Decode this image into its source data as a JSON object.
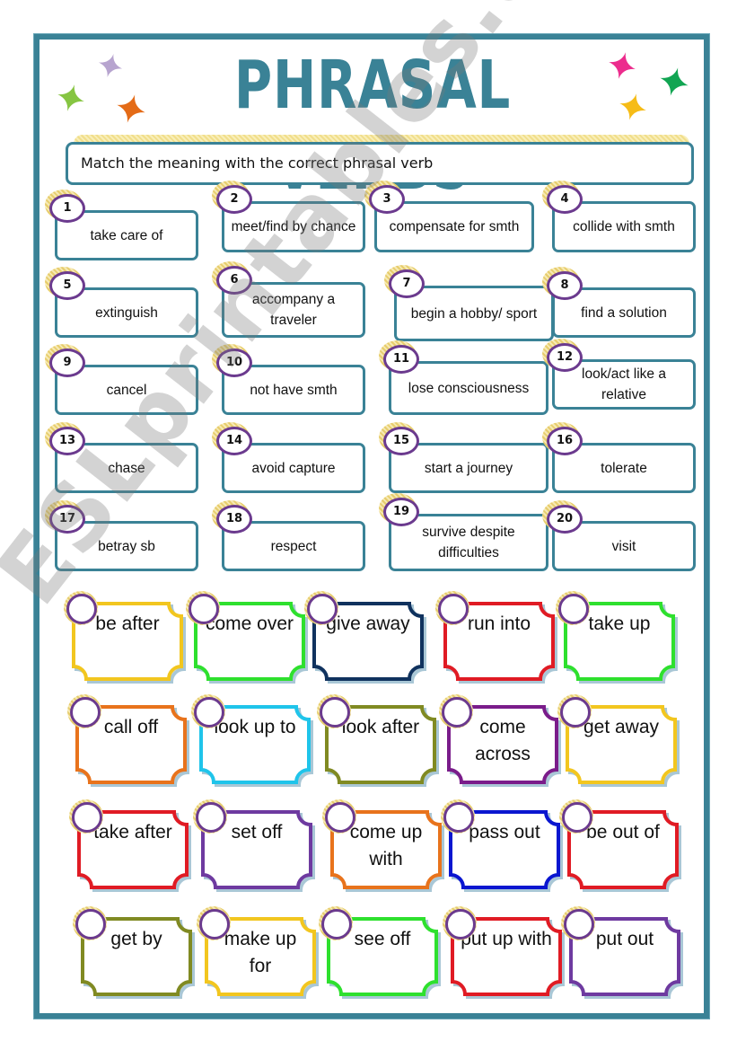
{
  "header": {
    "title": "PHRASAL VERBS",
    "instruction": "Match the meaning with the correct phrasal verb"
  },
  "stars": [
    {
      "name": "star-lavender",
      "color": "#b7a4cf"
    },
    {
      "name": "star-green",
      "color": "#86c542"
    },
    {
      "name": "star-orange",
      "color": "#e46b17"
    },
    {
      "name": "star-pink",
      "color": "#ec2c8d"
    },
    {
      "name": "star-emerald",
      "color": "#11a552"
    },
    {
      "name": "star-yellow",
      "color": "#f6bc17"
    }
  ],
  "colors": {
    "frame": "#3a8296",
    "number_circle": "#6b3a8e",
    "halo": "#e7cd6d"
  },
  "meanings": [
    {
      "number": "1",
      "text": "take care of"
    },
    {
      "number": "2",
      "text": "meet/find by chance"
    },
    {
      "number": "3",
      "text": "compensate for smth"
    },
    {
      "number": "4",
      "text": "collide with smth"
    },
    {
      "number": "5",
      "text": "extinguish"
    },
    {
      "number": "6",
      "text": "accompany a traveler"
    },
    {
      "number": "7",
      "text": "begin a hobby/ sport"
    },
    {
      "number": "8",
      "text": "find a solution"
    },
    {
      "number": "9",
      "text": "cancel"
    },
    {
      "number": "10",
      "text": "not have smth"
    },
    {
      "number": "11",
      "text": "lose consciousness"
    },
    {
      "number": "12",
      "text": "look/act like a relative"
    },
    {
      "number": "13",
      "text": "chase"
    },
    {
      "number": "14",
      "text": "avoid capture"
    },
    {
      "number": "15",
      "text": "start a journey"
    },
    {
      "number": "16",
      "text": "tolerate"
    },
    {
      "number": "17",
      "text": "betray sb"
    },
    {
      "number": "18",
      "text": "respect"
    },
    {
      "number": "19",
      "text": "survive despite difficulties"
    },
    {
      "number": "20",
      "text": "visit"
    }
  ],
  "phrasal_verbs": [
    {
      "text": "be after",
      "color": "#f2c61f"
    },
    {
      "text": "come over",
      "color": "#2ee02e"
    },
    {
      "text": "give away",
      "color": "#10325e"
    },
    {
      "text": "run into",
      "color": "#e01b24"
    },
    {
      "text": "take up",
      "color": "#2ee02e"
    },
    {
      "text": "call off",
      "color": "#e8731c"
    },
    {
      "text": "look up to",
      "color": "#1fc4ea"
    },
    {
      "text": "look after",
      "color": "#808a22"
    },
    {
      "text": "come across",
      "color": "#7a1c8a"
    },
    {
      "text": "get away",
      "color": "#f2c61f"
    },
    {
      "text": "take after",
      "color": "#e01b24"
    },
    {
      "text": "set off",
      "color": "#6e3aa0"
    },
    {
      "text": "come up with",
      "color": "#e8731c"
    },
    {
      "text": "pass out",
      "color": "#0a16d0"
    },
    {
      "text": "be out of",
      "color": "#e01b24"
    },
    {
      "text": "get by",
      "color": "#808a22"
    },
    {
      "text": "make up for",
      "color": "#f2c61f"
    },
    {
      "text": "see off",
      "color": "#2ee02e"
    },
    {
      "text": "put up with",
      "color": "#e01b24"
    },
    {
      "text": "put out",
      "color": "#6e3aa0"
    }
  ],
  "watermark": "ESLprintables.com"
}
